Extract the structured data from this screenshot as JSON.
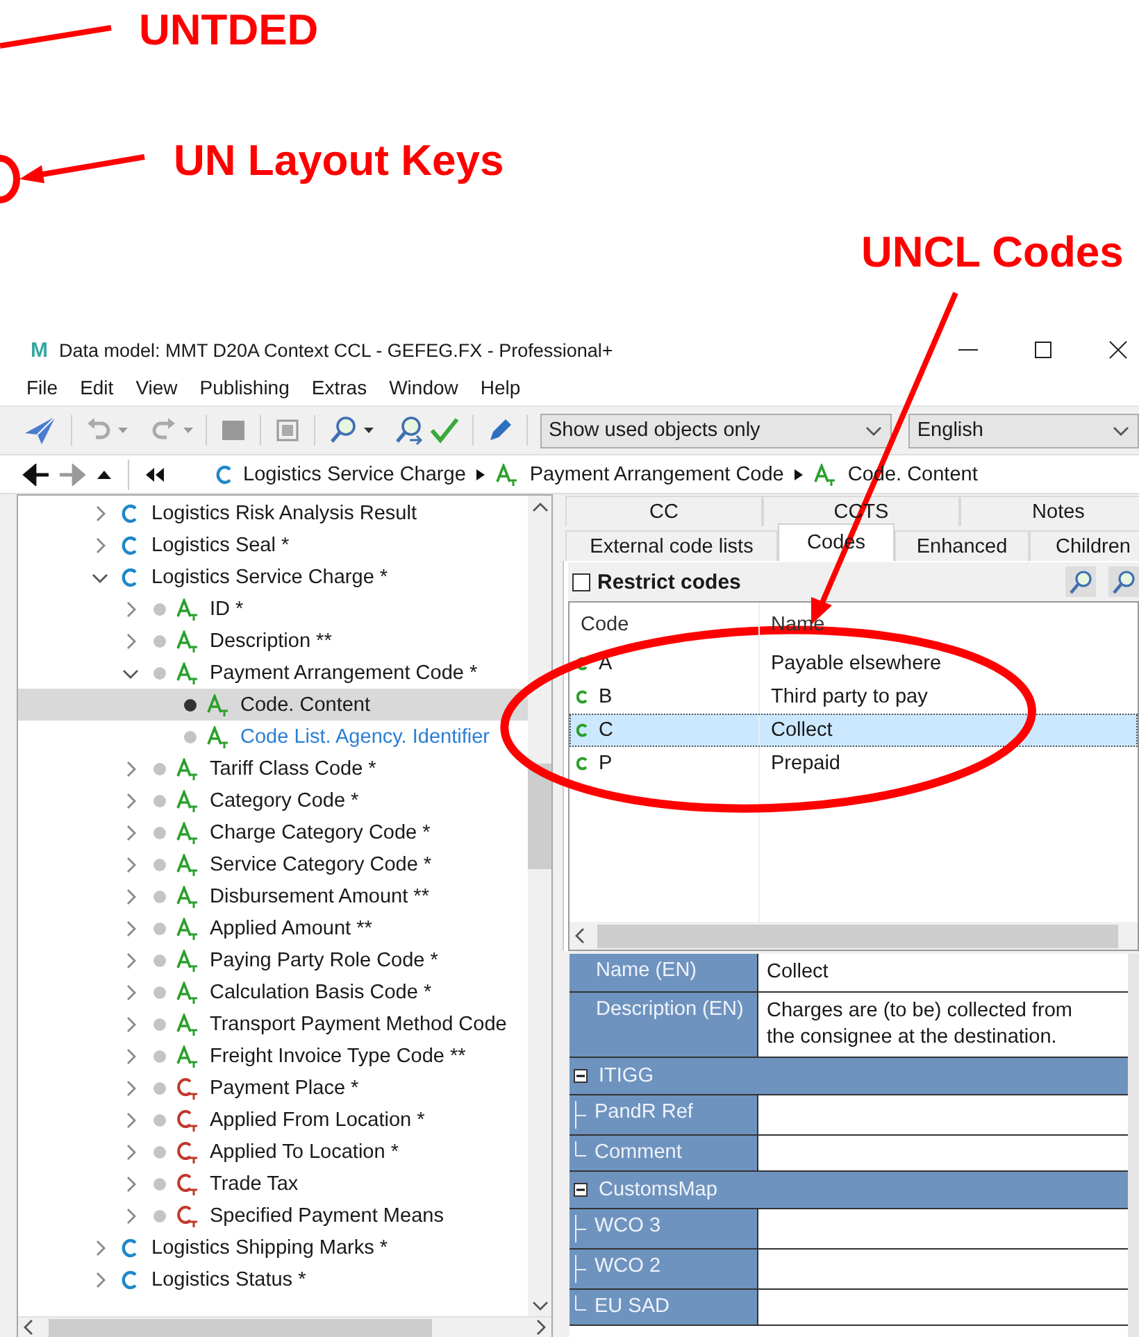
{
  "annotations": [
    {
      "text": "UNTDED"
    },
    {
      "text": "UN Layout Keys"
    },
    {
      "text": "UNCL Codes"
    }
  ],
  "window": {
    "logo": "M",
    "title": "Data model: MMT D20A Context CCL - GEFEG.FX - Professional+"
  },
  "menu": [
    "File",
    "Edit",
    "View",
    "Publishing",
    "Extras",
    "Window",
    "Help"
  ],
  "toolbar": {
    "filter": {
      "value": "Show used objects only"
    },
    "language": {
      "value": "English"
    }
  },
  "breadcrumb": [
    {
      "kind": "class",
      "label": "Logistics Service Charge"
    },
    {
      "kind": "attribute",
      "label": "Payment Arrangement Code"
    },
    {
      "kind": "attribute",
      "label": "Code. Content"
    }
  ],
  "tree": [
    {
      "kind": "class",
      "label": "Logistics Risk Analysis Result",
      "expanded": false,
      "selected": false
    },
    {
      "kind": "class",
      "label": "Logistics Seal *",
      "expanded": false,
      "selected": false
    },
    {
      "kind": "class",
      "label": "Logistics Service Charge *",
      "expanded": true,
      "selected": false,
      "children": [
        {
          "kind": "attribute",
          "label": "ID *",
          "expanded": false,
          "selected": false
        },
        {
          "kind": "attribute",
          "label": "Description **",
          "expanded": false,
          "selected": false
        },
        {
          "kind": "attribute",
          "label": "Payment Arrangement Code *",
          "expanded": true,
          "selected": false,
          "children": [
            {
              "kind": "attribute",
              "label": "Code. Content",
              "selected": true,
              "linked": false
            },
            {
              "kind": "attribute",
              "label": "Code List. Agency. Identifier",
              "selected": false,
              "linked": true
            }
          ]
        },
        {
          "kind": "attribute",
          "label": "Tariff Class Code *",
          "expanded": false,
          "selected": false
        },
        {
          "kind": "attribute",
          "label": "Category Code *",
          "expanded": false,
          "selected": false
        },
        {
          "kind": "attribute",
          "label": "Charge Category Code *",
          "expanded": false,
          "selected": false
        },
        {
          "kind": "attribute",
          "label": "Service Category Code *",
          "expanded": false,
          "selected": false
        },
        {
          "kind": "attribute",
          "label": "Disbursement Amount **",
          "expanded": false,
          "selected": false
        },
        {
          "kind": "attribute",
          "label": "Applied Amount **",
          "expanded": false,
          "selected": false
        },
        {
          "kind": "attribute",
          "label": "Paying Party Role Code *",
          "expanded": false,
          "selected": false
        },
        {
          "kind": "attribute",
          "label": "Calculation Basis Code *",
          "expanded": false,
          "selected": false
        },
        {
          "kind": "attribute",
          "label": "Transport Payment Method Code",
          "expanded": false,
          "selected": false
        },
        {
          "kind": "attribute",
          "label": "Freight Invoice Type Code **",
          "expanded": false,
          "selected": false
        },
        {
          "kind": "association",
          "label": "Payment Place *",
          "expanded": false,
          "selected": false
        },
        {
          "kind": "association",
          "label": "Applied From Location *",
          "expanded": false,
          "selected": false
        },
        {
          "kind": "association",
          "label": "Applied To Location *",
          "expanded": false,
          "selected": false
        },
        {
          "kind": "association",
          "label": "Trade Tax",
          "expanded": false,
          "selected": false
        },
        {
          "kind": "association",
          "label": "Specified Payment Means",
          "expanded": false,
          "selected": false
        }
      ]
    },
    {
      "kind": "class",
      "label": "Logistics Shipping Marks *",
      "expanded": false,
      "selected": false
    },
    {
      "kind": "class",
      "label": "Logistics Status *",
      "expanded": false,
      "selected": false
    }
  ],
  "tab_rows": [
    {
      "tabs": [
        {
          "label": "CC",
          "selected": false
        },
        {
          "label": "CCTS",
          "selected": false
        },
        {
          "label": "Notes",
          "selected": false
        }
      ]
    },
    {
      "tabs": [
        {
          "label": "External code lists",
          "selected": false
        },
        {
          "label": "Codes",
          "selected": true
        },
        {
          "label": "Enhanced",
          "selected": false
        },
        {
          "label": "Children",
          "selected": false
        }
      ]
    }
  ],
  "restrict_codes": {
    "label": "Restrict codes",
    "checked": false
  },
  "codes": {
    "columns": [
      "Code",
      "Name"
    ],
    "rows": [
      {
        "code": "A",
        "name": "Payable elsewhere",
        "selected": false
      },
      {
        "code": "B",
        "name": "Third party to pay",
        "selected": false
      },
      {
        "code": "C",
        "name": "Collect",
        "selected": true
      },
      {
        "code": "P",
        "name": "Prepaid",
        "selected": false
      }
    ]
  },
  "properties": [
    {
      "kind": "field",
      "label": "Name (EN)",
      "value": "Collect"
    },
    {
      "kind": "field",
      "label": "Description (EN)",
      "value": "Charges are (to be) collected from the consignee at the destination."
    },
    {
      "kind": "group",
      "label": "ITIGG",
      "expanded": true,
      "children": [
        {
          "label": "PandR Ref"
        },
        {
          "label": "Comment"
        }
      ]
    },
    {
      "kind": "group",
      "label": "CustomsMap",
      "expanded": true,
      "children": [
        {
          "label": "WCO 3"
        },
        {
          "label": "WCO 2"
        },
        {
          "label": "EU SAD"
        }
      ]
    }
  ]
}
